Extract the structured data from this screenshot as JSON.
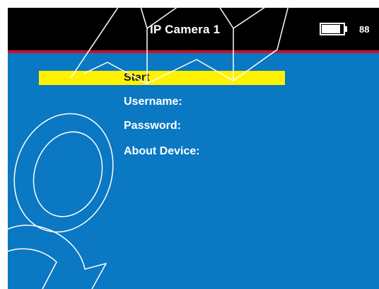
{
  "header": {
    "title": "IP Camera 1",
    "battery_level": 88,
    "battery_text": "88"
  },
  "menu": {
    "items": [
      {
        "label": "Start",
        "selected": true
      },
      {
        "label": "Username:",
        "selected": false
      },
      {
        "label": "Password:",
        "selected": false
      },
      {
        "label": "About Device:",
        "selected": false
      }
    ]
  },
  "colors": {
    "screen_background": "#0a78c2",
    "header_background": "#000000",
    "header_divider": "#c8102e",
    "selection_highlight": "#fff200",
    "text": "#ffffff"
  }
}
